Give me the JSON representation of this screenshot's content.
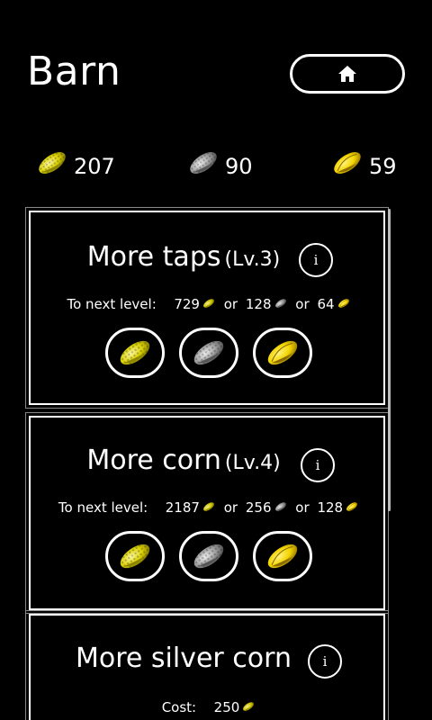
{
  "header": {
    "title": "Barn",
    "home_icon": "home-icon"
  },
  "currencies": [
    {
      "type": "gold-corn",
      "amount": "207"
    },
    {
      "type": "silver-corn",
      "amount": "90"
    },
    {
      "type": "yellow-corn",
      "amount": "59"
    }
  ],
  "colors": {
    "gold_corn": "#d8d000",
    "silver_corn": "#9a9a9a",
    "yellow_corn": "#f2d400",
    "background": "#000000",
    "foreground": "#ffffff"
  },
  "upgrades": [
    {
      "title": "More taps",
      "level": "(Lv.3)",
      "info_label": "i",
      "cost_label": "To next level:",
      "costs": [
        "729",
        "128",
        "64"
      ],
      "or_label": "or"
    },
    {
      "title": "More corn",
      "level": "(Lv.4)",
      "info_label": "i",
      "cost_label": "To next level:",
      "costs": [
        "2187",
        "256",
        "128"
      ],
      "or_label": "or"
    },
    {
      "title": "More silver corn",
      "info_label": "i",
      "cost_label": "Cost:",
      "cost": "250"
    }
  ]
}
